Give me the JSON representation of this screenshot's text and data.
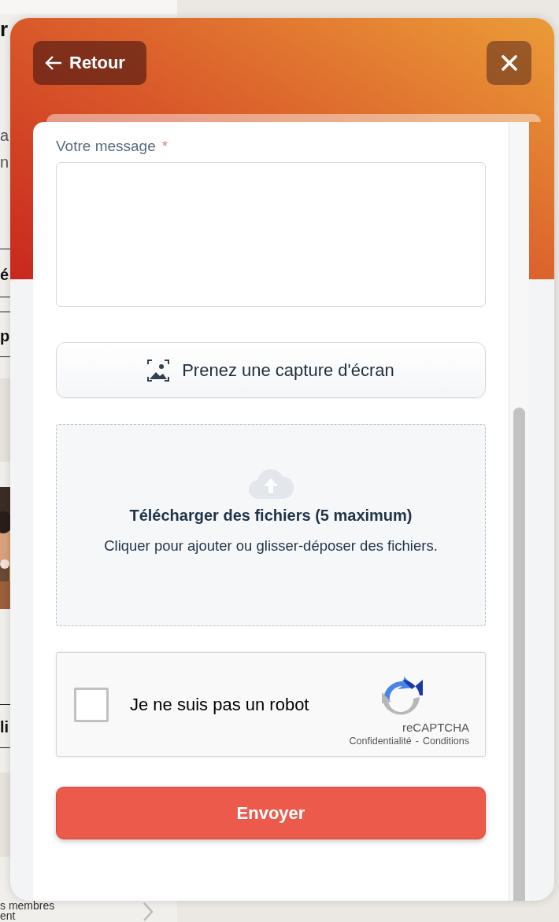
{
  "background_page": {
    "fragments": [
      {
        "kind": "heading",
        "text": "r"
      },
      {
        "kind": "plain",
        "text": "a"
      },
      {
        "kind": "plain",
        "text": "n"
      },
      {
        "kind": "bold",
        "text": "é"
      },
      {
        "kind": "bold",
        "text": "p"
      },
      {
        "kind": "picture"
      },
      {
        "kind": "bold",
        "text": "li"
      },
      {
        "kind": "small",
        "text": "s membres"
      },
      {
        "kind": "small",
        "text": "ent"
      }
    ]
  },
  "modal": {
    "back_button": "Retour",
    "message_field": {
      "label": "Votre message",
      "required_mark": "*"
    },
    "screenshot_button": "Prenez une capture d'écran",
    "upload": {
      "title": "Télécharger des fichiers (5 maximum)",
      "hint": "Cliquer pour ajouter ou glisser-déposer des fichiers."
    },
    "captcha": {
      "label": "Je ne suis pas un robot",
      "checked": false,
      "brand": "reCAPTCHA",
      "privacy": "Confidentialité",
      "separator": "-",
      "terms": "Conditions"
    },
    "submit_button": "Envoyer"
  }
}
